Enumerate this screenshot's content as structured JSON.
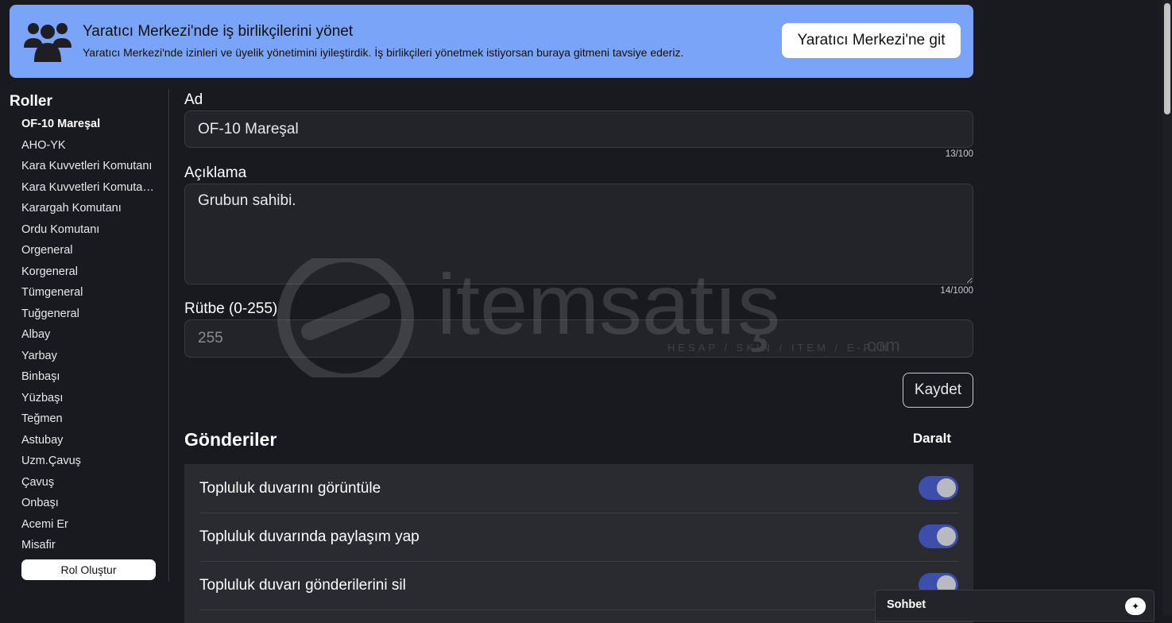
{
  "banner": {
    "title": "Yaratıcı Merkezi'nde iş birlikçilerini yönet",
    "subtitle": "Yaratıcı Merkezi'nde izinleri ve üyelik yönetimini iyileştirdik. İş birlikçileri yönetmek istiyorsan buraya gitmeni tavsiye ederiz.",
    "button_label": "Yaratıcı Merkezi'ne git",
    "icon": "group-icon",
    "color": "#7aa4f7"
  },
  "sidebar": {
    "title": "Roller",
    "roles": [
      "OF-10 Mareşal",
      "AHO-YK",
      "Kara Kuvvetleri Komutanı",
      "Kara Kuvvetleri Komutanı Yardımcısı",
      "Karargah Komutanı",
      "Ordu Komutanı",
      "Orgeneral",
      "Korgeneral",
      "Tümgeneral",
      "Tuğgeneral",
      "Albay",
      "Yarbay",
      "Binbaşı",
      "Yüzbaşı",
      "Teğmen",
      "Astubay",
      "Uzm.Çavuş",
      "Çavuş",
      "Onbaşı",
      "Acemi Er",
      "Misafir"
    ],
    "active_index": 0,
    "create_label": "Rol Oluştur"
  },
  "form": {
    "name_label": "Ad",
    "name_value": "OF-10 Mareşal",
    "name_counter": "13/100",
    "desc_label": "Açıklama",
    "desc_value": "Grubun sahibi.",
    "desc_counter": "14/1000",
    "rank_label": "Rütbe (0-255)",
    "rank_value": "255",
    "save_label": "Kaydet"
  },
  "permissions": {
    "section_title": "Gönderiler",
    "collapse_label": "Daralt",
    "items": [
      {
        "label": "Topluluk duvarını görüntüle",
        "enabled": true
      },
      {
        "label": "Topluluk duvarında paylaşım yap",
        "enabled": true
      },
      {
        "label": "Topluluk duvarı gönderilerini sil",
        "enabled": true
      }
    ],
    "toggle_on_color": "#3d4eab"
  },
  "watermark": {
    "brand": "itemsatış",
    "tagline": "HESAP / SKIN / ITEM / E-PIN",
    "suffix": ".com"
  },
  "chat": {
    "label": "Sohbet",
    "icon": "sparkle-icon"
  }
}
